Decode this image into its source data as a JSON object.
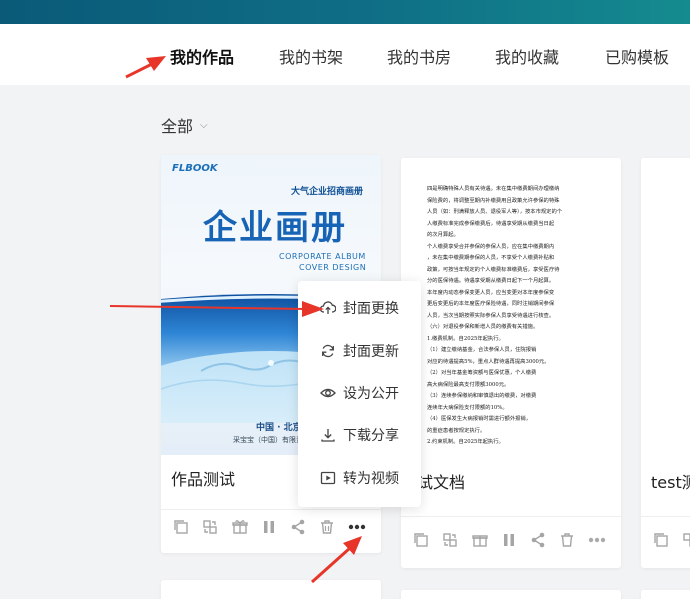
{
  "tabs": [
    {
      "label": "我的作品",
      "active": true
    },
    {
      "label": "我的书架",
      "active": false
    },
    {
      "label": "我的书房",
      "active": false
    },
    {
      "label": "我的收藏",
      "active": false
    },
    {
      "label": "已购模板",
      "active": false
    }
  ],
  "filter": {
    "label": "全部"
  },
  "cards": [
    {
      "title": "作品测试",
      "cover": {
        "logo": "FLBOOK",
        "small_title": "大气企业招商画册",
        "big_title": "企业画册",
        "en_line1": "CORPORATE ALBUM",
        "en_line2": "COVER DESIGN",
        "city": "中国 · 北京",
        "company": "采宝宝（中国）有限责任公司"
      }
    },
    {
      "title": "测试文档",
      "doc_lines": [
        "四是明确特殊人员有关待遇。未在集中缴费期间办理缴纳",
        "保险费的，将调整至期内补缴费用且政策允许参保的特殊",
        "人员（如：刑满释放人员、退役军人等），按本市规定的个",
        "人缴费标准完成参保缴费后，待遇享受期从缴费当日起",
        "的次月算起。",
        "个人缴费享受合并参保的参保人员，应在集中缴费期内",
        "，未在集中缴费期参保的人员，不享受个人缴费补贴和",
        "政策，可按当年规定的个人缴费标准缴费后，享受医疗待",
        "分的医保待遇。待遇享受期从缴费日起下一个月起算。",
        "本年度内动态参保变更人员，应当变更对本年度参保变",
        "更后变更后的本年度医疗保险待遇，同时注销期间参保",
        "人员，当次当期按照实际参保人员享受待遇进行核查。",
        "（六）对退役参保和新增人员的缴费有关措施。",
        "1.缴费机制。自2025年起执行。",
        "（1）建立缴纳基金，合法参保人员，住院报销",
        "对应的待遇提高5%，重点人群待遇再提高3000元。",
        "（2）对当年基金筹资额与医保优惠，个人缴费",
        "高大病保险最高支付限额3000元。",
        "（3）连续参保缴纳和审慎退出的缴费，对缴费",
        "连续年大病保险支付限额的10%。",
        "（4）医保发生大病报销时需进行额外报销，",
        "的重症患者按规定执行。",
        "2.约束机制。自2025年起执行。"
      ]
    },
    {
      "title": "test测"
    }
  ],
  "menu": {
    "items": [
      {
        "label": "封面更换",
        "icon": "upload-cloud-icon"
      },
      {
        "label": "封面更新",
        "icon": "refresh-icon"
      },
      {
        "label": "设为公开",
        "icon": "eye-icon"
      },
      {
        "label": "下载分享",
        "icon": "download-icon"
      },
      {
        "label": "转为视频",
        "icon": "video-icon"
      }
    ]
  },
  "card_actions": [
    "copy-icon",
    "transfer-icon",
    "gift-icon",
    "pause-icon",
    "share-icon",
    "trash-icon",
    "more-icon"
  ],
  "colors": {
    "topbar_start": "#0a5a78",
    "topbar_end": "#148b8f",
    "arrow": "#e8352a",
    "cover_blue": "#1763b5"
  }
}
